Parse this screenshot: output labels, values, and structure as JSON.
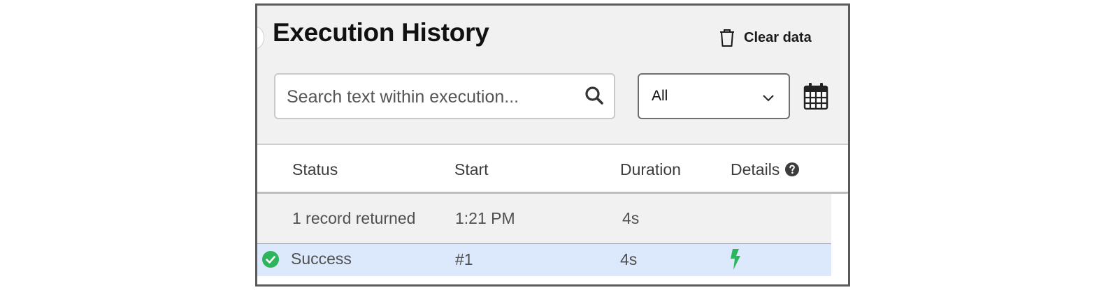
{
  "header": {
    "title": "Execution History",
    "clear_label": "Clear data"
  },
  "filters": {
    "search_placeholder": "Search text within execution...",
    "status_selected": "All"
  },
  "table": {
    "columns": [
      "Status",
      "Start",
      "Duration",
      "Details"
    ],
    "summary": {
      "status": "1 record returned",
      "start": "1:21 PM",
      "duration": "4s"
    },
    "rows": [
      {
        "status": "Success",
        "start": "#1",
        "duration": "4s",
        "status_color": "#2db55d",
        "details_icon_color": "#2db55d"
      }
    ]
  },
  "colors": {
    "panel_bg": "#f1f1f2",
    "selected_row": "#dce8fb",
    "success": "#2db55d"
  }
}
